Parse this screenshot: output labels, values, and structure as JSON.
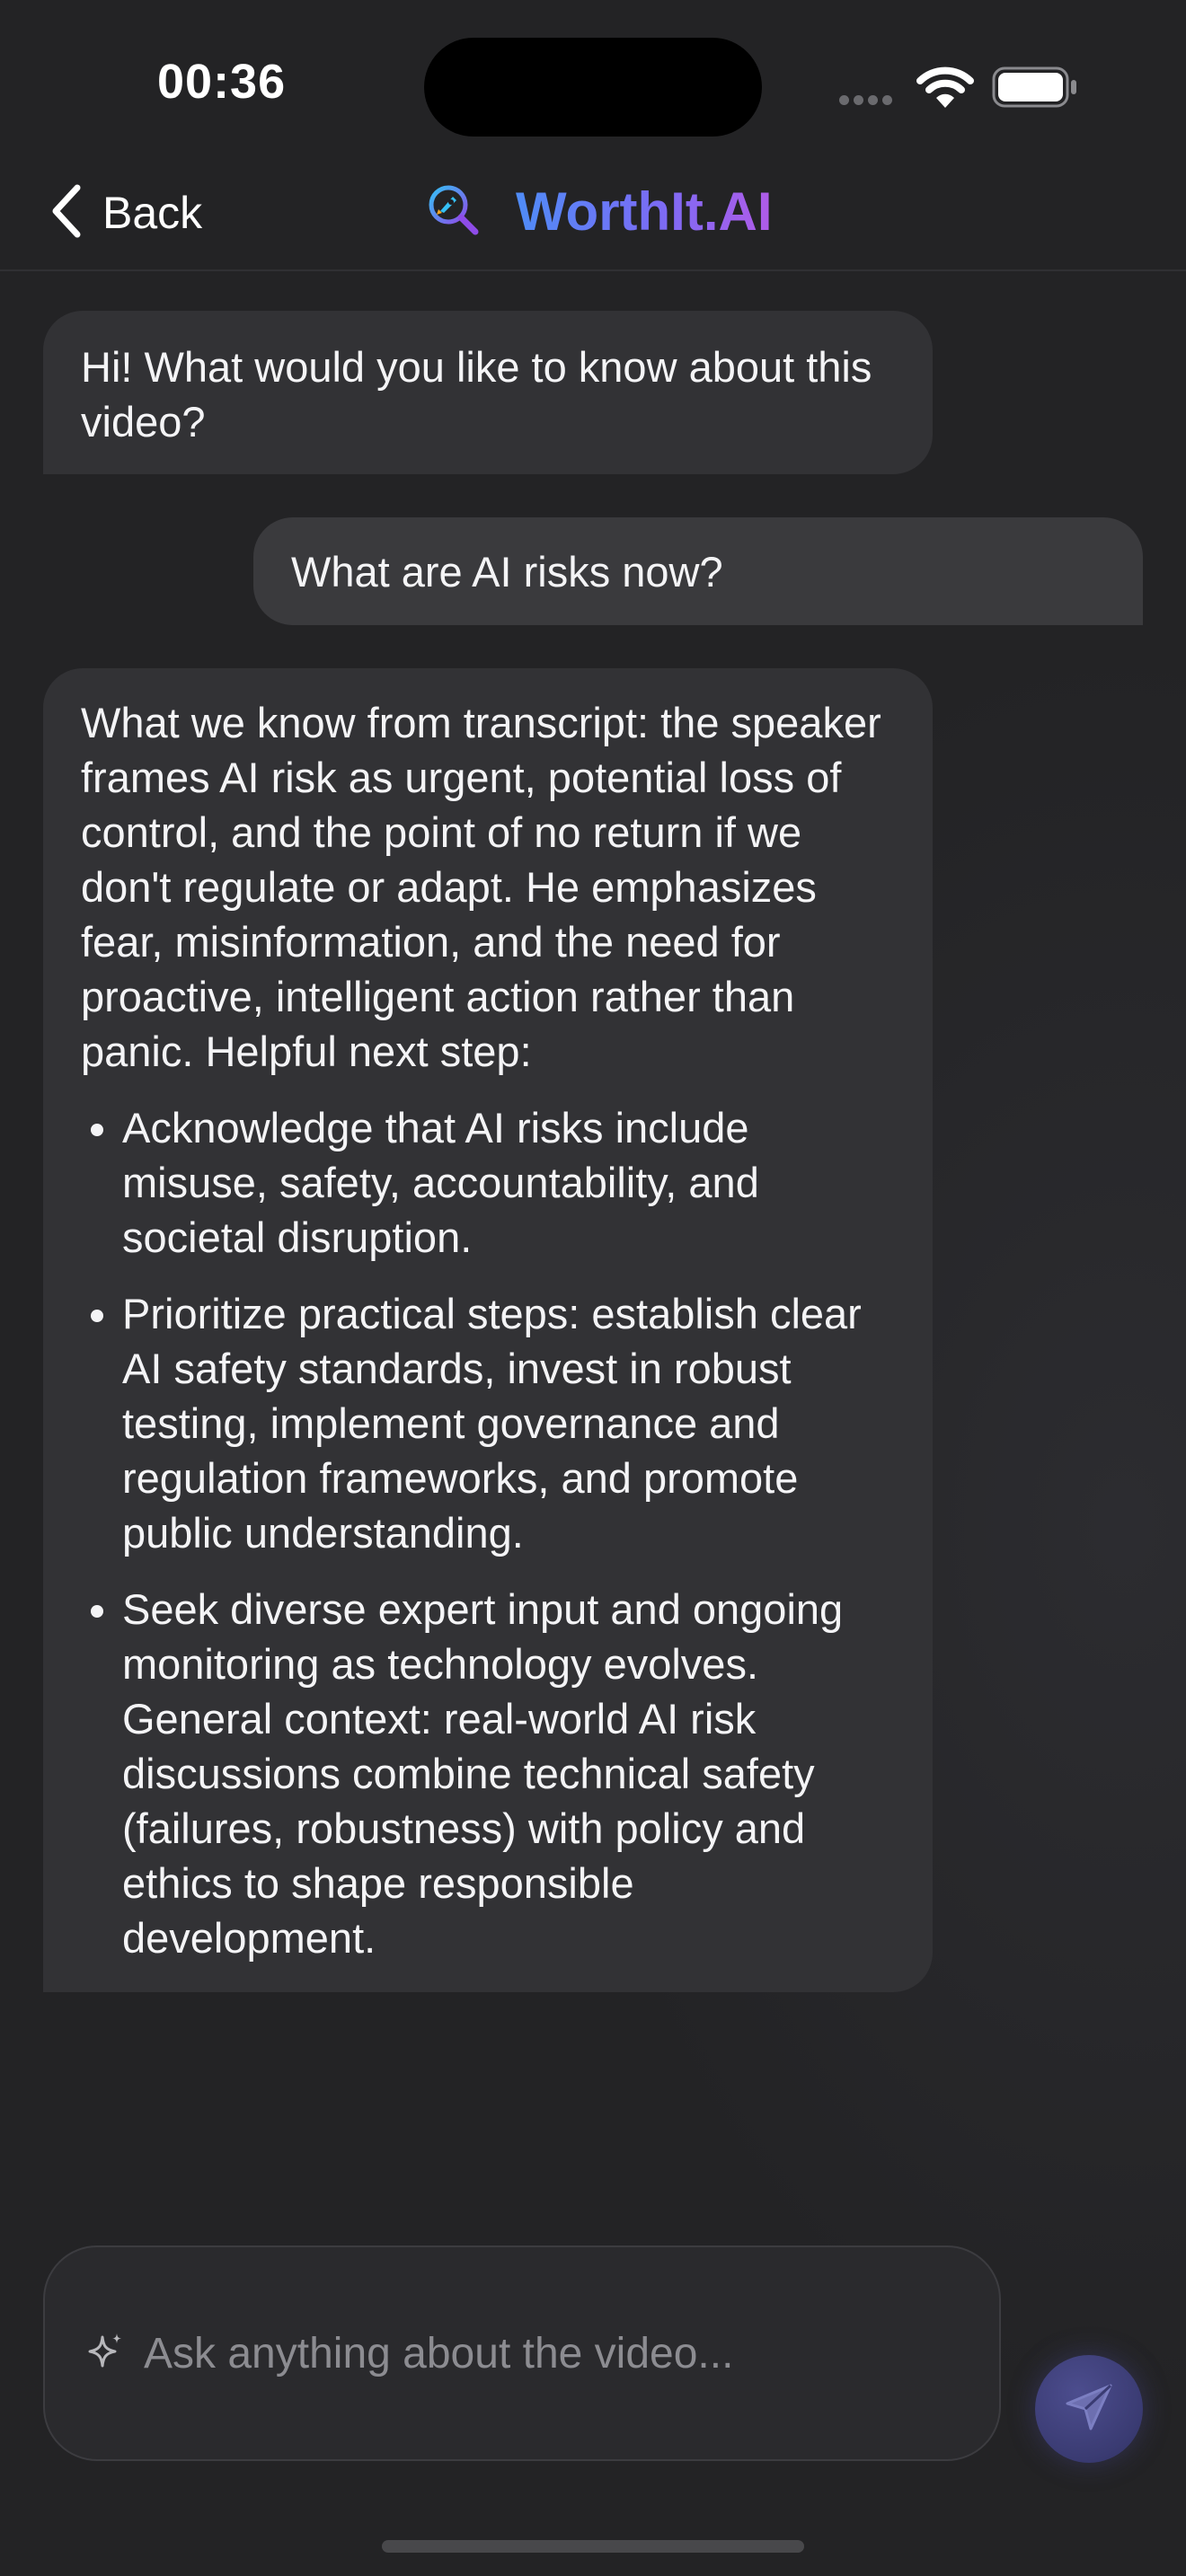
{
  "status_bar": {
    "time": "00:36"
  },
  "nav": {
    "back_label": "Back",
    "brand_name": "WorthIt.AI"
  },
  "messages": [
    {
      "role": "assistant",
      "text": "Hi! What would you like to know about this video?"
    },
    {
      "role": "user",
      "text": "What are AI risks now?"
    },
    {
      "role": "assistant",
      "intro": "What we know from transcript: the speaker frames AI risk as urgent, potential loss of control, and the point of no return if we don't regulate or adapt. He emphasizes fear, misinformation, and the need for proactive, intelligent action rather than panic. Helpful next step:",
      "bullets": [
        "Acknowledge that AI risks include misuse, safety, accountability, and societal disruption.",
        "Prioritize practical steps: establish clear AI safety standards, invest in robust testing, implement governance and regulation frameworks, and promote public understanding.",
        "Seek diverse expert input and ongoing monitoring as technology evolves. General context: real-world AI risk discussions combine technical safety (failures, robustness) with policy and ethics to shape responsible development."
      ]
    }
  ],
  "composer": {
    "placeholder": "Ask anything about the video...",
    "value": ""
  },
  "icons": {
    "back": "chevron-left-icon",
    "brand": "rocket-magnifier-icon",
    "composer": "sparkle-icon",
    "send": "paper-plane-icon"
  },
  "colors": {
    "background": "#232325",
    "bubble": "#323235",
    "brand_start": "#4f8cf7",
    "brand_end": "#b05be8"
  }
}
